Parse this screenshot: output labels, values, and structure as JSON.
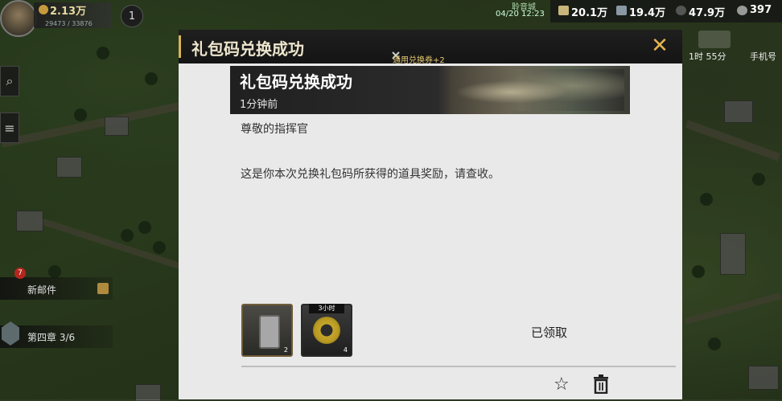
{
  "hud": {
    "power": "2.13万",
    "exp": "29473 / 33876",
    "level": "1",
    "server_name": "聆音城",
    "server_time": "04/20 12:23",
    "resources": [
      {
        "icon": "food-icon",
        "value": "20.1万"
      },
      {
        "icon": "steel-icon",
        "value": "19.4万"
      },
      {
        "icon": "oil-icon",
        "value": "47.9万"
      },
      {
        "icon": "gold-icon",
        "value": "397"
      }
    ]
  },
  "side": {
    "mail_badge": "7",
    "mail_label": "新邮件",
    "chapter_label": "第四章 3/6"
  },
  "right": {
    "timer": "1时 55分",
    "mobile_label": "手机号"
  },
  "dialog": {
    "title": "礼包码兑换成功",
    "close_glyph": "✕",
    "ticker": "通用兑换券+2",
    "mail_title": "礼包码兑换成功",
    "mail_time": "1分钟前",
    "greeting": "尊敬的指挥官",
    "body": "这是你本次兑换礼包码所获得的道具奖励，请查收。",
    "items": [
      {
        "name": "voucher-item",
        "count": "2",
        "tag": ""
      },
      {
        "name": "speedup-item",
        "count": "4",
        "tag": "3小时"
      }
    ],
    "claimed": "已领取",
    "star_glyph": "☆"
  },
  "colors": {
    "accent": "#d8b457",
    "dialog_bg": "#e9e9e9",
    "header_bg": "#1a1a1a"
  }
}
